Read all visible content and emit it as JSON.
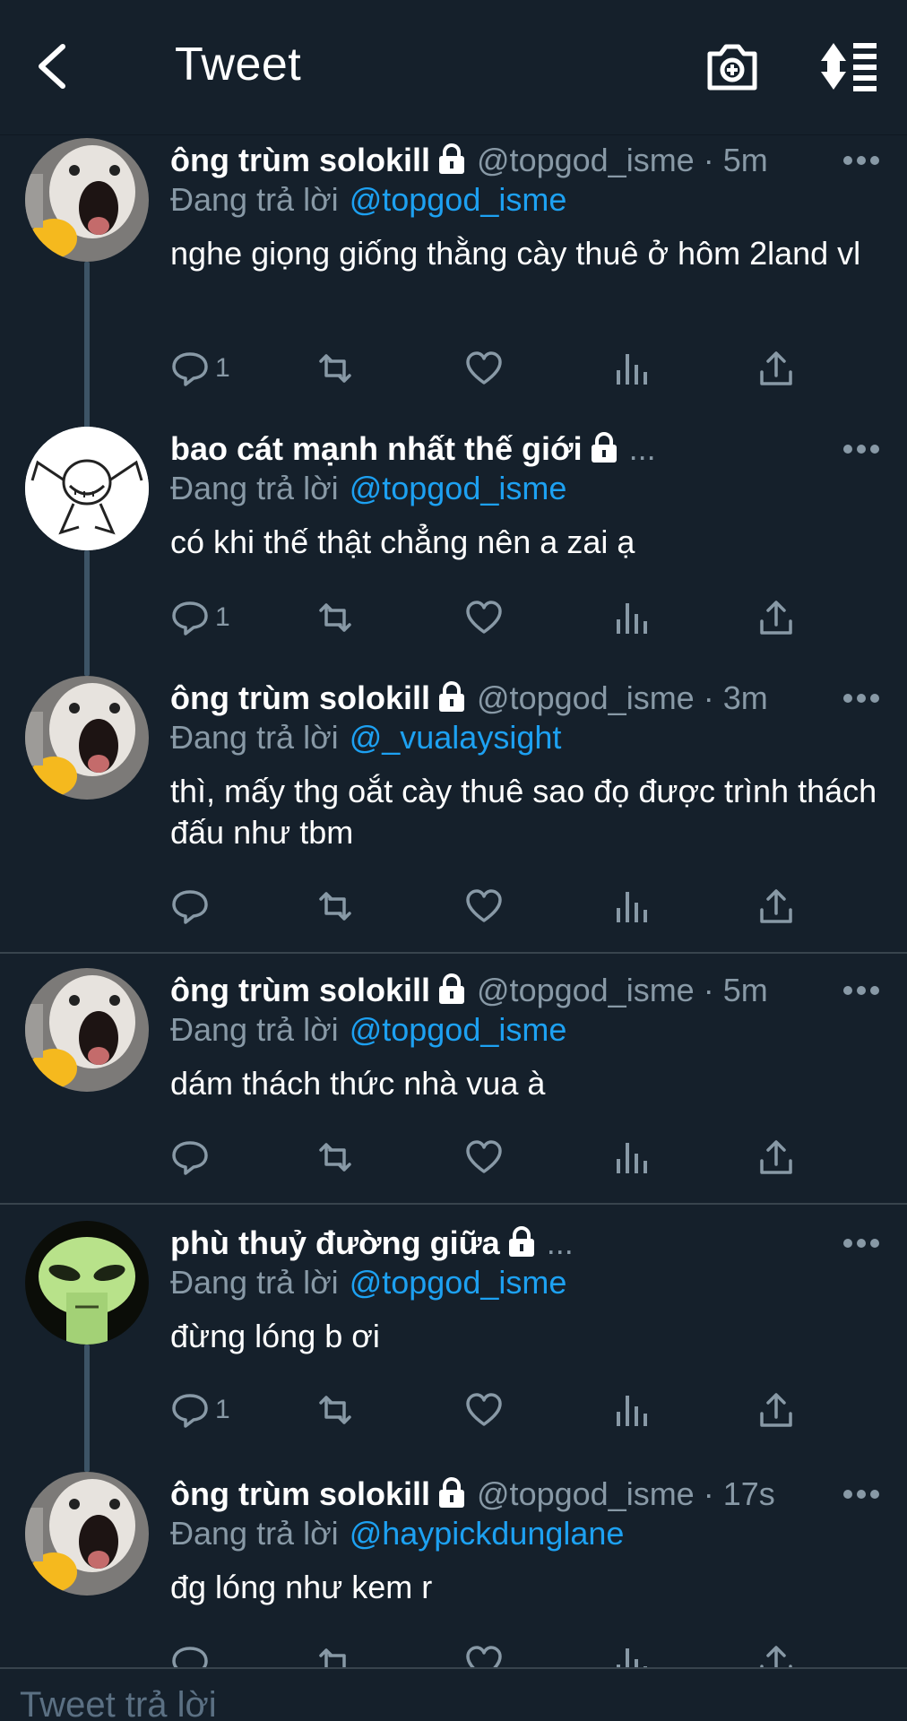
{
  "header": {
    "title": "Tweet",
    "back_icon": "back-arrow-icon",
    "camera_icon": "camera-plus-icon",
    "sort_icon": "sort-list-icon"
  },
  "colors": {
    "background": "#15202b",
    "text": "#ffffff",
    "muted": "#8899a6",
    "mention": "#1da1f2",
    "divider": "#38444d",
    "thread_line": "#3d5466"
  },
  "tweets": [
    {
      "name": "ông trùm solokill",
      "handle": "@topgod_isme · 5m",
      "replying_label": "Đang trả lời",
      "mention": "@topgod_isme",
      "text": "nghe giọng giống thằng cày thuê ở hôm 2land vl",
      "reply_count": "1"
    },
    {
      "name": "bao cát mạnh nhất thế giới",
      "handle": "...",
      "replying_label": "Đang trả lời",
      "mention": "@topgod_isme",
      "text": "có khi thế thật chẳng nên a zai ạ",
      "reply_count": "1"
    },
    {
      "name": "ông trùm solokill",
      "handle": "@topgod_isme · 3m",
      "replying_label": "Đang trả lời",
      "mention": "@_vualaysight",
      "text": "thì, mấy thg oắt cày thuê sao đọ được trình thách đấu như tbm",
      "reply_count": ""
    },
    {
      "name": "ông trùm solokill",
      "handle": "@topgod_isme · 5m",
      "replying_label": "Đang trả lời",
      "mention": "@topgod_isme",
      "text": "dám thách thức nhà vua à",
      "reply_count": ""
    },
    {
      "name": "phù thuỷ đường giữa",
      "handle": "...",
      "replying_label": "Đang trả lời",
      "mention": "@topgod_isme",
      "text": "đừng lóng b ơi",
      "reply_count": "1"
    },
    {
      "name": "ông trùm solokill",
      "handle": "@topgod_isme · 17s",
      "replying_label": "Đang trả lời",
      "mention": "@haypickdunglane",
      "text": "đg lóng như kem r",
      "reply_count": ""
    }
  ],
  "compose": {
    "placeholder": "Tweet trả lời"
  }
}
